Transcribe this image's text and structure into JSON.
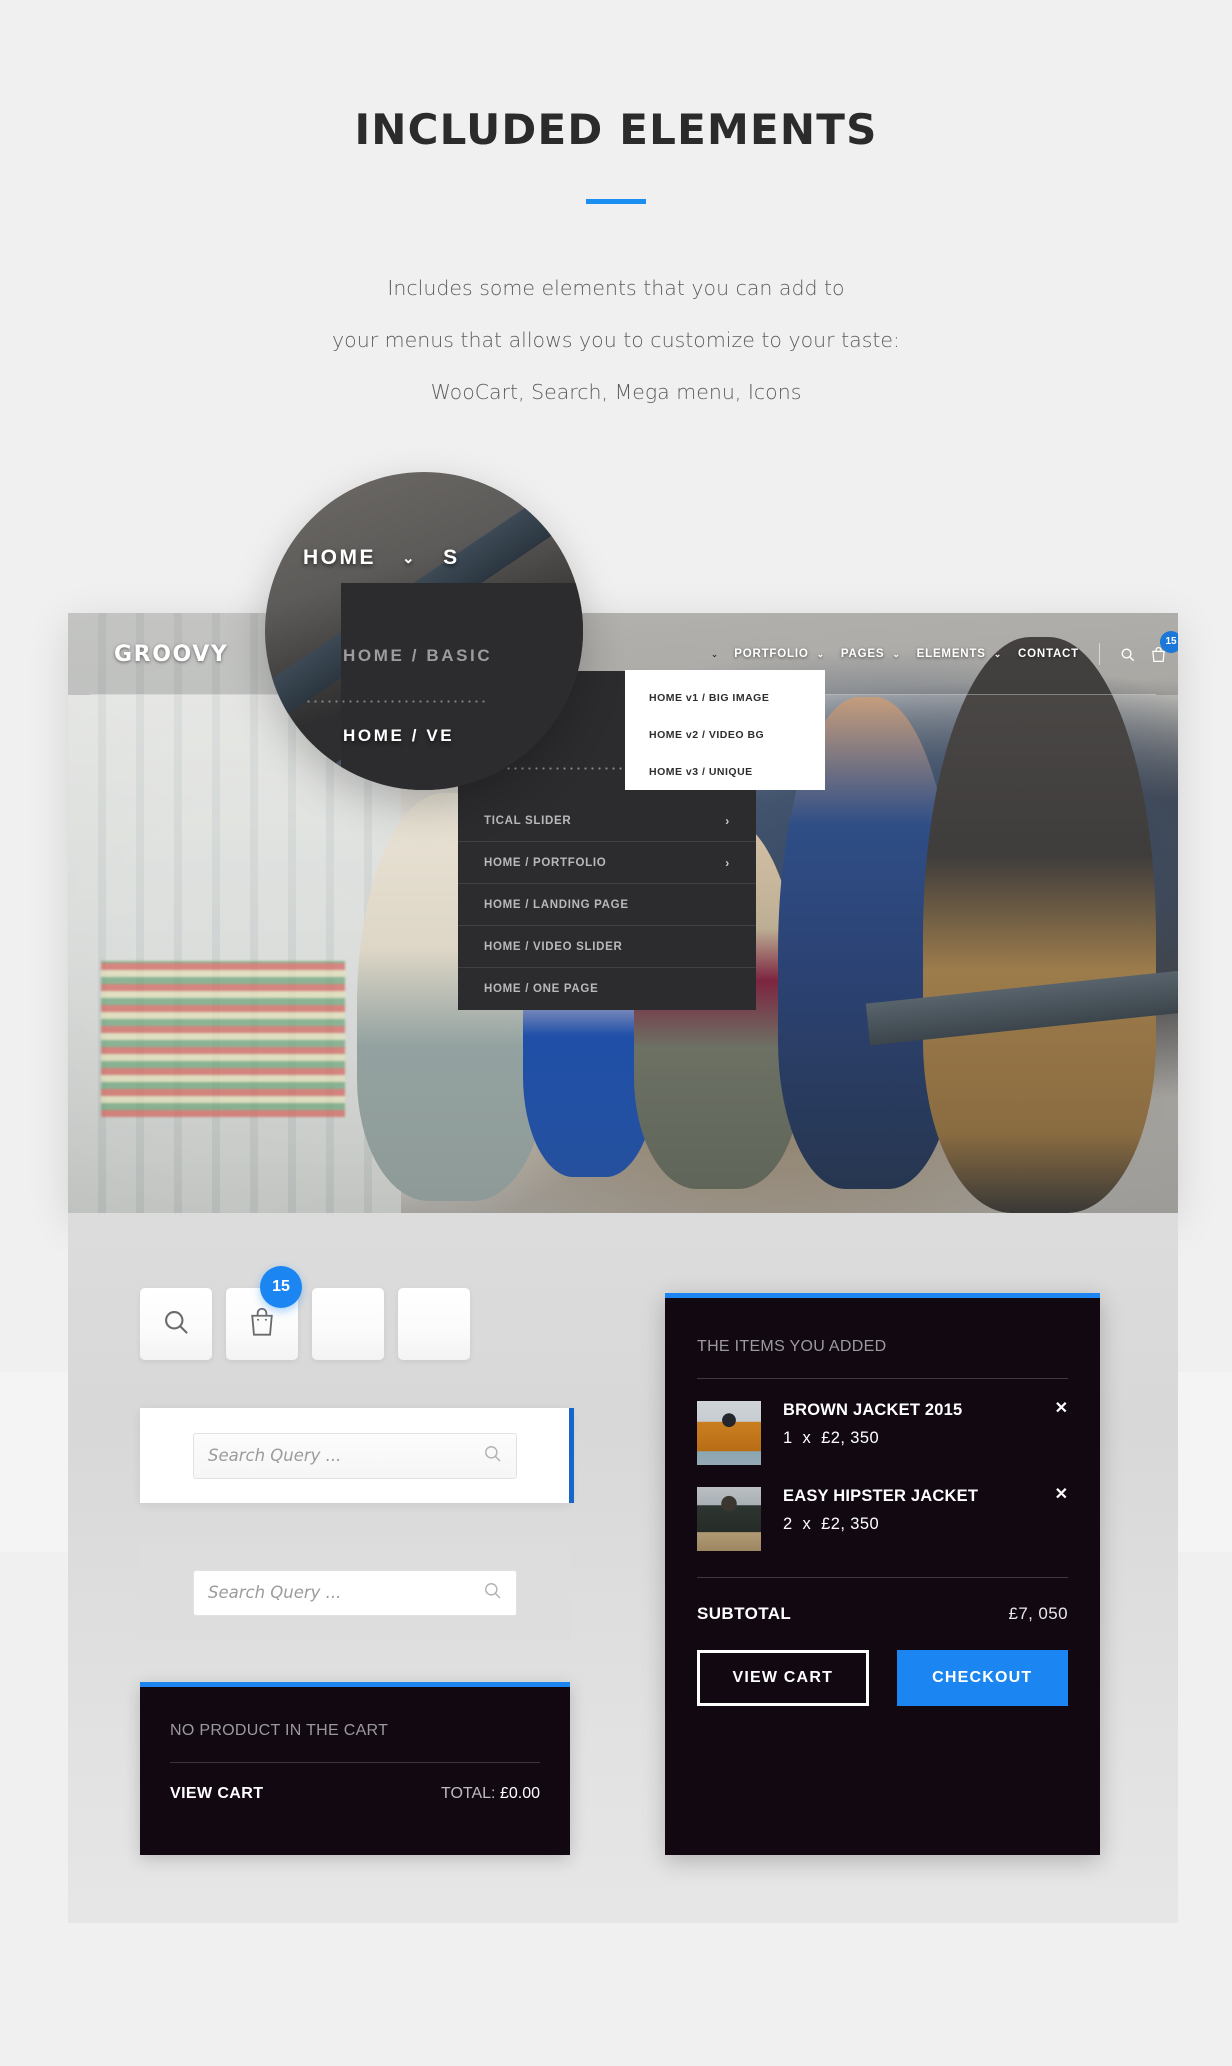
{
  "header": {
    "title": "INCLUDED ELEMENTS",
    "description_lines": [
      "Includes some elements that you can add to",
      "your menus that allows you to customize to your taste:",
      "WooCart, Search, Mega menu, Icons"
    ],
    "accent_color": "#1b8ef2"
  },
  "magnifier": {
    "home_label": "HOME",
    "chevron": "⌄",
    "next_letter": "S",
    "item_basic": "HOME  /  BASIC",
    "item_vertical": "HOME  /  VE"
  },
  "hero": {
    "brand": "GROOVY",
    "nav_items": [
      {
        "label": "PORTFOLIO",
        "has_chevron": true
      },
      {
        "label": "PAGES",
        "has_chevron": true
      },
      {
        "label": "ELEMENTS",
        "has_chevron": true
      },
      {
        "label": "CONTACT",
        "has_chevron": false
      }
    ],
    "leading_chevron": "⌄",
    "search_icon": "search-icon",
    "cart_icon": "shopping-bag-icon",
    "cart_badge": "15",
    "mega_menu": {
      "header_item": "HOME  /  BASIC",
      "rows": [
        {
          "label": "TICAL SLIDER",
          "arrow": "›"
        },
        {
          "label": "HOME  /  PORTFOLIO",
          "arrow": "›"
        },
        {
          "label": "HOME  /  LANDING PAGE",
          "arrow": ""
        },
        {
          "label": "HOME  /  VIDEO SLIDER",
          "arrow": ""
        },
        {
          "label": "HOME  /  ONE PAGE",
          "arrow": ""
        }
      ]
    },
    "sub_menu": [
      "HOME v1  /  BIG IMAGE",
      "HOME v2  /  VIDEO BG",
      "HOME v3  /  UNIQUE"
    ]
  },
  "icon_row": {
    "boxes": [
      {
        "icon": "search-icon",
        "badge": ""
      },
      {
        "icon": "shopping-bag-icon",
        "badge": "15"
      },
      {
        "icon": "",
        "badge": ""
      },
      {
        "icon": "",
        "badge": ""
      }
    ]
  },
  "search_widgets": [
    {
      "placeholder": "Search Query ...",
      "value": "",
      "icon": "search-icon",
      "accent": "#1766c9"
    },
    {
      "placeholder": "Search Query ...",
      "value": "",
      "icon": "search-icon",
      "accent": ""
    }
  ],
  "cart_empty": {
    "accent_color": "#1b86f2",
    "title": "NO PRODUCT IN THE CART",
    "view_cart_label": "VIEW CART",
    "total_label": "TOTAL:",
    "total_value": "£0.00"
  },
  "cart_full": {
    "accent_color": "#1b86f2",
    "title": "THE ITEMS YOU ADDED",
    "items": [
      {
        "name": "BROWN JACKET 2015",
        "quantity": "1",
        "multiplier": "x",
        "price": "£2, 350",
        "remove_icon": "✕",
        "thumb": "brown-jacket-thumb"
      },
      {
        "name": "EASY HIPSTER JACKET",
        "quantity": "2",
        "multiplier": "x",
        "price": "£2, 350",
        "remove_icon": "✕",
        "thumb": "hipster-jacket-thumb"
      }
    ],
    "subtotal_label": "SUBTOTAL",
    "subtotal_value": "£7, 050",
    "view_cart_label": "VIEW CART",
    "checkout_label": "CHECKOUT"
  }
}
